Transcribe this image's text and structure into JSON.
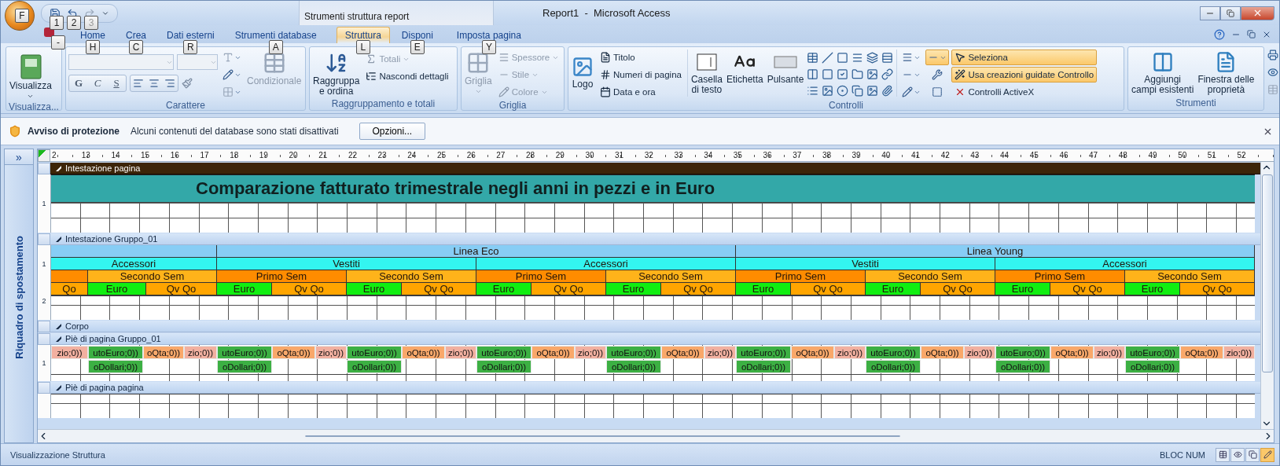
{
  "title_bar": {
    "office_keytip": "F",
    "quick_access": [
      {
        "keytip": "1",
        "disabled": false
      },
      {
        "keytip": "2",
        "disabled": false
      },
      {
        "keytip": "3",
        "disabled": true
      }
    ],
    "contextual_tab": "Strumenti struttura report",
    "title": "Report1  -  Microsoft Access"
  },
  "app_keytip": "-",
  "tabs": [
    {
      "label": "Home",
      "keytip": "H",
      "selected": false
    },
    {
      "label": "Crea",
      "keytip": "C",
      "selected": false
    },
    {
      "label": "Dati esterni",
      "keytip": "R",
      "selected": false
    },
    {
      "label": "Strumenti database",
      "keytip": "A",
      "selected": false
    },
    {
      "label": "Struttura",
      "keytip": "L",
      "selected": true
    },
    {
      "label": "Disponi",
      "keytip": "E",
      "selected": false
    },
    {
      "label": "Imposta pagina",
      "keytip": "Y",
      "selected": false
    }
  ],
  "ribbon": [
    {
      "kind": "view",
      "label": "Visualizza...",
      "button": "Visualizza"
    },
    {
      "kind": "font",
      "label": "Carattere",
      "format_buttons": [
        "G",
        "C",
        "S"
      ],
      "conditional": {
        "label": "Condizionale",
        "disabled": true
      }
    },
    {
      "kind": "grouping",
      "label": "Raggruppamento e totali",
      "large": {
        "lines": [
          "Raggruppa",
          "e ordina"
        ]
      },
      "small": [
        {
          "label": "Totali",
          "disabled": true
        },
        {
          "label": "Nascondi dettagli",
          "disabled": false
        }
      ]
    },
    {
      "kind": "grid",
      "label": "Griglia",
      "large": {
        "label": "Griglia",
        "disabled": true
      },
      "small": [
        {
          "label": "Spessore",
          "disabled": true
        },
        {
          "label": "Stile",
          "disabled": true
        },
        {
          "label": "Colore",
          "disabled": true
        }
      ]
    },
    {
      "kind": "controls",
      "label": "Controlli",
      "logo": "Logo",
      "small": [
        "Titolo",
        "Numeri di pagina",
        "Data e ora"
      ],
      "large": [
        {
          "lines": [
            "Casella",
            "di testo"
          ]
        },
        {
          "lines": [
            "Etichetta"
          ]
        },
        {
          "lines": [
            "Pulsante"
          ]
        }
      ],
      "shape_button": {
        "selected": true
      },
      "toggles": [
        {
          "label": "Seleziona",
          "selected": true
        },
        {
          "label": "Usa creazioni guidate Controllo",
          "selected": true
        },
        {
          "label": "Controlli ActiveX",
          "selected": false
        }
      ]
    },
    {
      "kind": "tools",
      "label": "Strumenti",
      "large": [
        {
          "lines": [
            "Aggiungi",
            "campi esistenti"
          ]
        },
        {
          "lines": [
            "Finestra delle",
            "proprietà"
          ]
        }
      ]
    }
  ],
  "message_bar": {
    "title": "Avviso di protezione",
    "message": "Alcuni contenuti del database sono stati disattivati",
    "button": "Opzioni..."
  },
  "nav_pane": {
    "toggle": "»",
    "label": "Riquadro di spostamento"
  },
  "ruler": [
    "2",
    "13",
    "14",
    "15",
    "16",
    "17",
    "18",
    "19",
    "20",
    "21",
    "22",
    "23",
    "24",
    "25",
    "26",
    "27",
    "28",
    "29",
    "30",
    "31",
    "32",
    "33",
    "34",
    "35",
    "36",
    "37",
    "38",
    "39",
    "40",
    "41",
    "42",
    "43",
    "44",
    "45",
    "46",
    "47",
    "48",
    "49",
    "50",
    "51",
    "52"
  ],
  "sections": [
    {
      "kind": "page_header",
      "label": "Intestazione pagina",
      "selected": true,
      "title": "Comparazione fatturato trimestrale negli anni in pezzi e in Euro",
      "ruler_marks": [
        "1"
      ]
    },
    {
      "kind": "group_header",
      "label": "Intestazione Gruppo_01",
      "selected": false,
      "ruler_marks": [
        "1",
        "2"
      ],
      "header_rows": [
        [
          {
            "text": "Linea Eco"
          },
          {
            "text": "Linea Young"
          }
        ],
        [
          {
            "text": "Accessori"
          },
          {
            "text": "Vestiti"
          },
          {
            "text": "Accessori"
          },
          {
            "text": "Vestiti"
          },
          {
            "text": "Accessori"
          }
        ],
        [
          {
            "text": "Secondo Sem",
            "color": "#ffb31a"
          },
          {
            "text": "Primo Sem",
            "color": "#ff8c00"
          },
          {
            "text": "Secondo Sem",
            "color": "#ffb31a"
          },
          {
            "text": "Primo Sem",
            "color": "#ff8c00"
          },
          {
            "text": "Secondo Sem",
            "color": "#ffb31a"
          },
          {
            "text": "Primo Sem",
            "color": "#ff8c00"
          },
          {
            "text": "Secondo Sem",
            "color": "#ffb31a"
          },
          {
            "text": "Primo Sem",
            "color": "#ff8c00"
          },
          {
            "text": "Secondo Sem",
            "color": "#ffb31a"
          }
        ],
        [
          {
            "text": "Qo",
            "color": "#ffa500"
          },
          {
            "text": "Euro",
            "color": "#11ee11"
          },
          {
            "text": "Qv Qo",
            "color": "#ffa500"
          },
          {
            "text": "Euro",
            "color": "#11ee11"
          },
          {
            "text": "Qv Qo",
            "color": "#ffa500"
          },
          {
            "text": "Euro",
            "color": "#11ee11"
          },
          {
            "text": "Qv Qo",
            "color": "#ffa500"
          },
          {
            "text": "Euro",
            "color": "#11ee11"
          },
          {
            "text": "Qv Qo",
            "color": "#ffa500"
          },
          {
            "text": "Euro",
            "color": "#11ee11"
          },
          {
            "text": "Qv Qo",
            "color": "#ffa500"
          },
          {
            "text": "Euro",
            "color": "#11ee11"
          },
          {
            "text": "Qv Qo",
            "color": "#ffa500"
          },
          {
            "text": "Euro",
            "color": "#11ee11"
          },
          {
            "text": "Qv Qo",
            "color": "#ffa500"
          },
          {
            "text": "Euro",
            "color": "#11ee11"
          },
          {
            "text": "Qv Qo",
            "color": "#ffa500"
          },
          {
            "text": "Euro",
            "color": "#11ee11"
          },
          {
            "text": "Qv Qo",
            "color": "#ffa500"
          }
        ]
      ]
    },
    {
      "kind": "detail",
      "label": "Corpo",
      "selected": false
    },
    {
      "kind": "group_footer",
      "label": "Piè di pagina Gruppo_01",
      "selected": false,
      "ruler_marks": [
        "1"
      ],
      "field_rows": [
        [
          {
            "text": "zio;0))",
            "color": "#f2b0a0"
          },
          {
            "text": "utoEuro;0))",
            "color": "#3cb043"
          },
          {
            "text": "oQta;0))",
            "color": "#f9a86a"
          },
          {
            "text": "zio;0))",
            "color": "#f2b0a0"
          },
          {
            "text": "utoEuro;0))",
            "color": "#3cb043"
          },
          {
            "text": "oQta;0))",
            "color": "#f9a86a"
          },
          {
            "text": "zio;0))",
            "color": "#f2b0a0"
          },
          {
            "text": "utoEuro;0))",
            "color": "#3cb043"
          },
          {
            "text": "oQta;0))",
            "color": "#f9a86a"
          },
          {
            "text": "zio;0))",
            "color": "#f2b0a0"
          },
          {
            "text": "utoEuro;0))",
            "color": "#3cb043"
          },
          {
            "text": "oQta;0))",
            "color": "#f9a86a"
          },
          {
            "text": "zio;0))",
            "color": "#f2b0a0"
          },
          {
            "text": "utoEuro;0))",
            "color": "#3cb043"
          },
          {
            "text": "oQta;0))",
            "color": "#f9a86a"
          },
          {
            "text": "zio;0))",
            "color": "#f2b0a0"
          },
          {
            "text": "utoEuro;0))",
            "color": "#3cb043"
          },
          {
            "text": "oQta;0))",
            "color": "#f9a86a"
          },
          {
            "text": "zio;0))",
            "color": "#f2b0a0"
          },
          {
            "text": "utoEuro;0))",
            "color": "#3cb043"
          },
          {
            "text": "oQta;0))",
            "color": "#f9a86a"
          },
          {
            "text": "zio;0))",
            "color": "#f2b0a0"
          },
          {
            "text": "utoEuro;0))",
            "color": "#3cb043"
          },
          {
            "text": "oQta;0))",
            "color": "#f9a86a"
          },
          {
            "text": "zio;0))",
            "color": "#f2b0a0"
          },
          {
            "text": "utoEuro;0))",
            "color": "#3cb043"
          },
          {
            "text": "oQta;0))",
            "color": "#f9a86a"
          },
          {
            "text": "zio;0))",
            "color": "#f2b0a0"
          }
        ],
        [
          {
            "text": "oDollari;0))",
            "color": "#3cb043"
          },
          {
            "text": "oDollari;0))",
            "color": "#3cb043"
          },
          {
            "text": "oDollari;0))",
            "color": "#3cb043"
          },
          {
            "text": "oDollari;0))",
            "color": "#3cb043"
          },
          {
            "text": "oDollari;0))",
            "color": "#3cb043"
          },
          {
            "text": "oDollari;0))",
            "color": "#3cb043"
          },
          {
            "text": "oDollari;0))",
            "color": "#3cb043"
          },
          {
            "text": "oDollari;0))",
            "color": "#3cb043"
          },
          {
            "text": "oDollari;0))",
            "color": "#3cb043"
          }
        ]
      ]
    },
    {
      "kind": "page_footer",
      "label": "Piè di pagina pagina",
      "selected": false
    }
  ],
  "status_bar": {
    "left": "Visualizzazione Struttura",
    "right": "BLOC NUM",
    "view_buttons": [
      {
        "selected": false
      },
      {
        "selected": false
      },
      {
        "selected": false
      },
      {
        "selected": true
      }
    ]
  }
}
